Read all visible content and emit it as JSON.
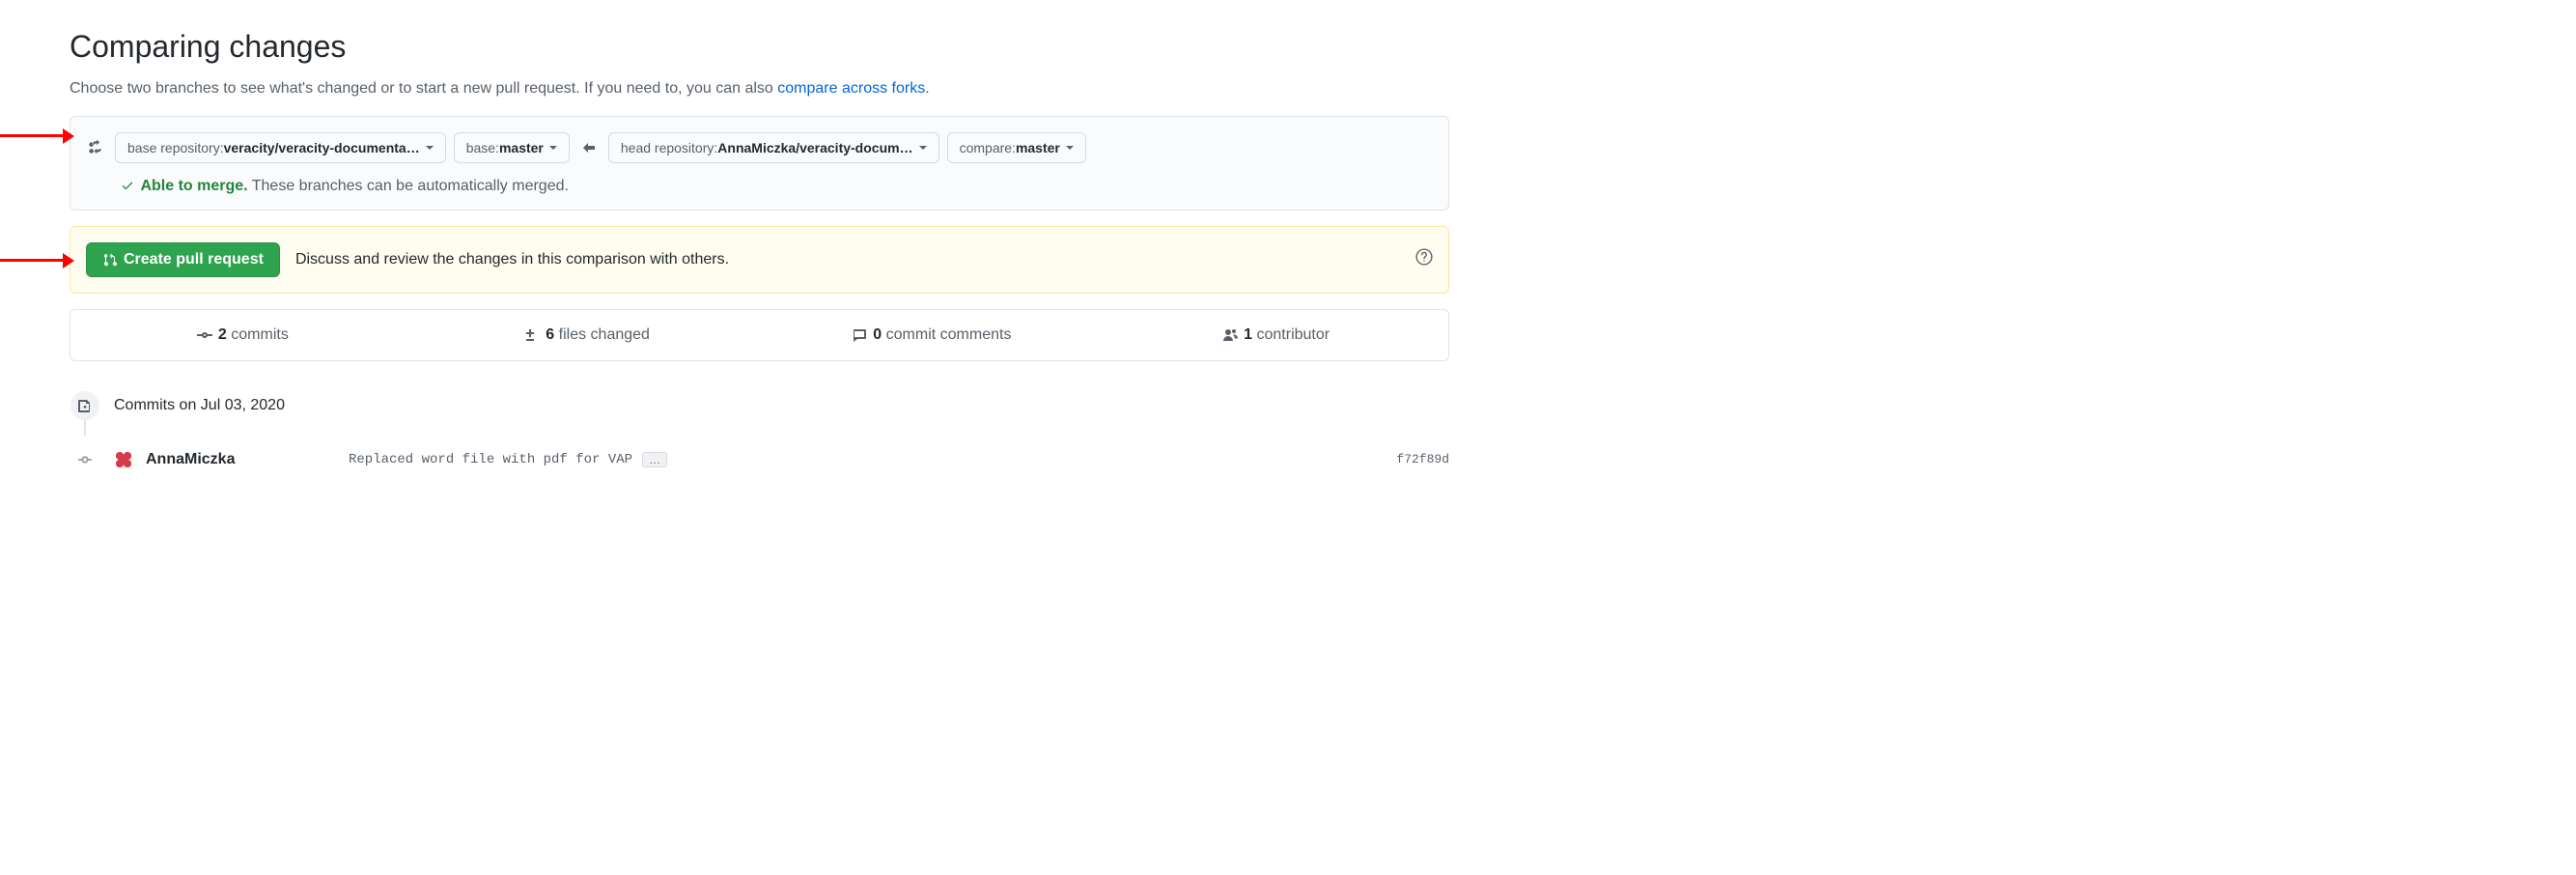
{
  "header": {
    "title": "Comparing changes",
    "subtitle_prefix": "Choose two branches to see what's changed or to start a new pull request. If you need to, you can also ",
    "subtitle_link": "compare across forks",
    "subtitle_suffix": "."
  },
  "range": {
    "base_repo_label": "base repository: ",
    "base_repo_value": "veracity/veracity-documenta…",
    "base_label": "base: ",
    "base_value": "master",
    "head_repo_label": "head repository: ",
    "head_repo_value": "AnnaMiczka/veracity-docum…",
    "compare_label": "compare: ",
    "compare_value": "master",
    "merge_status_ok": "Able to merge.",
    "merge_status_tail": " These branches can be automatically merged."
  },
  "pr_prompt": {
    "button": "Create pull request",
    "description": "Discuss and review the changes in this comparison with others."
  },
  "stats": {
    "commits_n": "2",
    "commits_label": " commits",
    "files_n": "6",
    "files_label": " files changed",
    "comments_n": "0",
    "comments_label": " commit comments",
    "contributors_n": "1",
    "contributors_label": " contributor"
  },
  "timeline": {
    "day_heading": "Commits on Jul 03, 2020",
    "commit": {
      "author": "AnnaMiczka",
      "message": "Replaced word file with pdf for VAP",
      "sha": "f72f89d"
    }
  }
}
